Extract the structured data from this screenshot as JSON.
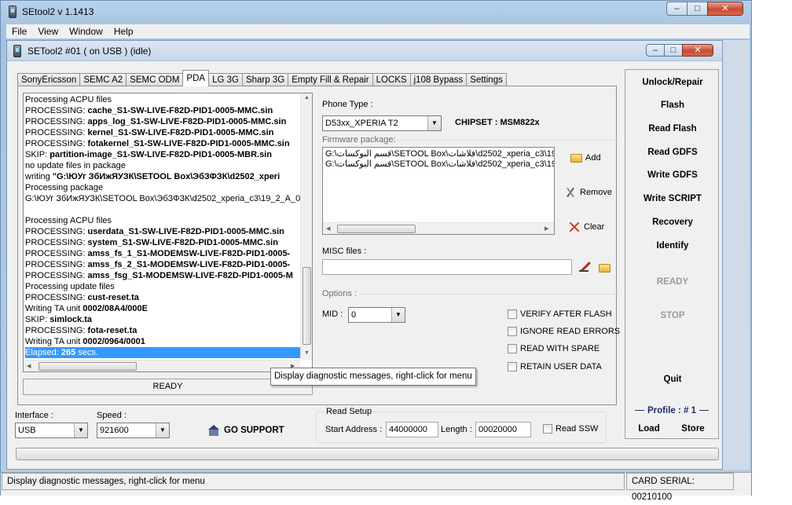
{
  "window": {
    "title": "SEtool2 v 1.1413",
    "menu": [
      "File",
      "View",
      "Window",
      "Help"
    ]
  },
  "inner_window": {
    "title": "SETool2 #01 ( on USB ) (idle)"
  },
  "caption_buttons": {
    "minimize": "–",
    "maximize": "□",
    "close": "✕"
  },
  "tabs": [
    "SonyEricsson",
    "SEMC A2",
    "SEMC ODM",
    "PDA",
    "LG 3G",
    "Sharp 3G",
    "Empty Fill & Repair",
    "LOCKS",
    "j108 Bypass",
    "Settings"
  ],
  "active_tab": "PDA",
  "log": {
    "lines": [
      {
        "prefix": "Processing ACPU files",
        "bold": ""
      },
      {
        "prefix": "PROCESSING: ",
        "bold": "cache_S1-SW-LIVE-F82D-PID1-0005-MMC.sin"
      },
      {
        "prefix": "PROCESSING: ",
        "bold": "apps_log_S1-SW-LIVE-F82D-PID1-0005-MMC.sin"
      },
      {
        "prefix": "PROCESSING: ",
        "bold": "kernel_S1-SW-LIVE-F82D-PID1-0005-MMC.sin"
      },
      {
        "prefix": "PROCESSING: ",
        "bold": "fotakernel_S1-SW-LIVE-F82D-PID1-0005-MMC.sin"
      },
      {
        "prefix": "SKIP: ",
        "bold": "partition-image_S1-SW-LIVE-F82D-PID1-0005-MBR.sin"
      },
      {
        "prefix": "no update files in package",
        "bold": ""
      },
      {
        "prefix": "writing ",
        "bold": "\"G:\\ЮУг ЗбИжЯУЗК\\SETOOL Box\\ЭбЗФЗК\\d2502_xperi"
      },
      {
        "prefix": "Processing package",
        "bold": ""
      },
      {
        "prefix": "G:\\ЮУг ЗбИжЯУЗК\\SETOOL Box\\ЭбЗФЗК\\d2502_xperia_c3\\19_2_A_0_",
        "bold": ""
      },
      {
        "prefix": "",
        "bold": ""
      },
      {
        "prefix": "Processing ACPU files",
        "bold": ""
      },
      {
        "prefix": "PROCESSING: ",
        "bold": "userdata_S1-SW-LIVE-F82D-PID1-0005-MMC.sin"
      },
      {
        "prefix": "PROCESSING: ",
        "bold": "system_S1-SW-LIVE-F82D-PID1-0005-MMC.sin"
      },
      {
        "prefix": "PROCESSING: ",
        "bold": "amss_fs_1_S1-MODEMSW-LIVE-F82D-PID1-0005-"
      },
      {
        "prefix": "PROCESSING: ",
        "bold": "amss_fs_2_S1-MODEMSW-LIVE-F82D-PID1-0005-"
      },
      {
        "prefix": "PROCESSING: ",
        "bold": "amss_fsg_S1-MODEMSW-LIVE-F82D-PID1-0005-M"
      },
      {
        "prefix": "Processing update files",
        "bold": ""
      },
      {
        "prefix": "PROCESSING: ",
        "bold": "cust-reset.ta"
      },
      {
        "prefix": "Writing TA unit ",
        "bold": "0002/08A4/000E"
      },
      {
        "prefix": "SKIP: ",
        "bold": "simlock.ta"
      },
      {
        "prefix": "PROCESSING: ",
        "bold": "fota-reset.ta"
      },
      {
        "prefix": "Writing TA unit ",
        "bold": "0002/0964/0001"
      },
      {
        "prefix": "Elapsed: ",
        "bold": "265",
        "suffix": " secs."
      }
    ],
    "status": "READY"
  },
  "phone": {
    "type_label": "Phone Type :",
    "type_value": "D53xx_XPERIA T2",
    "chipset_label": "CHIPSET : MSM822x"
  },
  "firmware": {
    "label": "Firmware package:",
    "files": [
      "G:\\قسم البوكسات\\SETOOL Box\\فلاشات\\d2502_xperia_c3\\19",
      "G:\\قسم البوكسات\\SETOOL Box\\فلاشات\\d2502_xperia_c3\\19"
    ],
    "add": "Add",
    "remove": "Remove",
    "clear": "Clear"
  },
  "misc": {
    "label": "MISC files :",
    "value": ""
  },
  "options": {
    "label": "Options :",
    "mid_label": "MID :",
    "mid_value": "0",
    "checks": [
      "VERIFY AFTER FLASH",
      "IGNORE READ ERRORS",
      "READ WITH SPARE",
      "RETAIN USER DATA"
    ]
  },
  "tooltip": "Display diagnostic messages, right-click for menu",
  "commands": {
    "unlock": "Unlock/Repair",
    "flash": "Flash",
    "read_flash": "Read Flash",
    "read_gdfs": "Read GDFS",
    "write_gdfs": "Write GDFS",
    "write_script": "Write SCRIPT",
    "recovery": "Recovery",
    "identify": "Identify",
    "ready": "READY",
    "stop": "STOP",
    "quit": "Quit",
    "profile": "Profile : # 1",
    "load": "Load",
    "store": "Store"
  },
  "connection": {
    "interface_label": "Interface :",
    "interface_value": "USB",
    "speed_label": "Speed :",
    "speed_value": "921600",
    "go_support": "GO SUPPORT"
  },
  "read_setup": {
    "label": "Read Setup",
    "start_label": "Start Address :",
    "start_value": "44000000",
    "length_label": "Length :",
    "length_value": "00020000",
    "ssw_label": "Read SSW"
  },
  "statusbar": {
    "message": "Display diagnostic messages, right-click for menu",
    "card_serial": "CARD SERIAL: 00210100"
  }
}
